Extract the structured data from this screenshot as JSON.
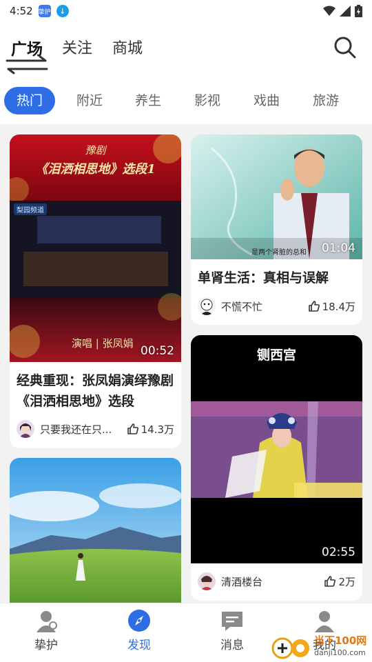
{
  "status": {
    "time": "4:52",
    "app_badge": "挚护"
  },
  "top_tabs": [
    {
      "label": "广场",
      "active": true
    },
    {
      "label": "关注",
      "active": false
    },
    {
      "label": "商城",
      "active": false
    }
  ],
  "categories": [
    {
      "label": "热门",
      "active": true
    },
    {
      "label": "附近",
      "active": false
    },
    {
      "label": "养生",
      "active": false
    },
    {
      "label": "影视",
      "active": false
    },
    {
      "label": "戏曲",
      "active": false
    },
    {
      "label": "旅游",
      "active": false
    }
  ],
  "cards": {
    "c1": {
      "banner_tag": "豫剧",
      "banner_title": "《泪洒相思地》选段1",
      "channel": "梨园频道",
      "overlay_caption": "演唱 | 张凤娟",
      "duration": "00:52",
      "title": "经典重现：张凤娟演绎豫剧《泪洒相思地》选段",
      "author": "只要我还在只...",
      "likes": "14.3万"
    },
    "c2": {
      "subtitle": "是两个肾脏的总和",
      "duration": "01:04",
      "title": "单肾生活：真相与误解",
      "author": "不慌不忙",
      "likes": "18.4万"
    },
    "c3": {
      "top_caption": "铡西宫",
      "duration": "02:55",
      "author": "清酒楼台",
      "likes": "2万"
    }
  },
  "bottom_nav": [
    {
      "label": "挚护",
      "icon": "user-icon",
      "active": false
    },
    {
      "label": "发现",
      "icon": "compass-icon",
      "active": true
    },
    {
      "label": "消息",
      "icon": "message-icon",
      "active": false
    },
    {
      "label": "我的",
      "icon": "profile-icon",
      "active": false
    }
  ],
  "watermark": {
    "text": "当下100网",
    "url": "danji100.com"
  },
  "colors": {
    "accent": "#2f6de6",
    "feed_bg": "#f2f2f2"
  }
}
